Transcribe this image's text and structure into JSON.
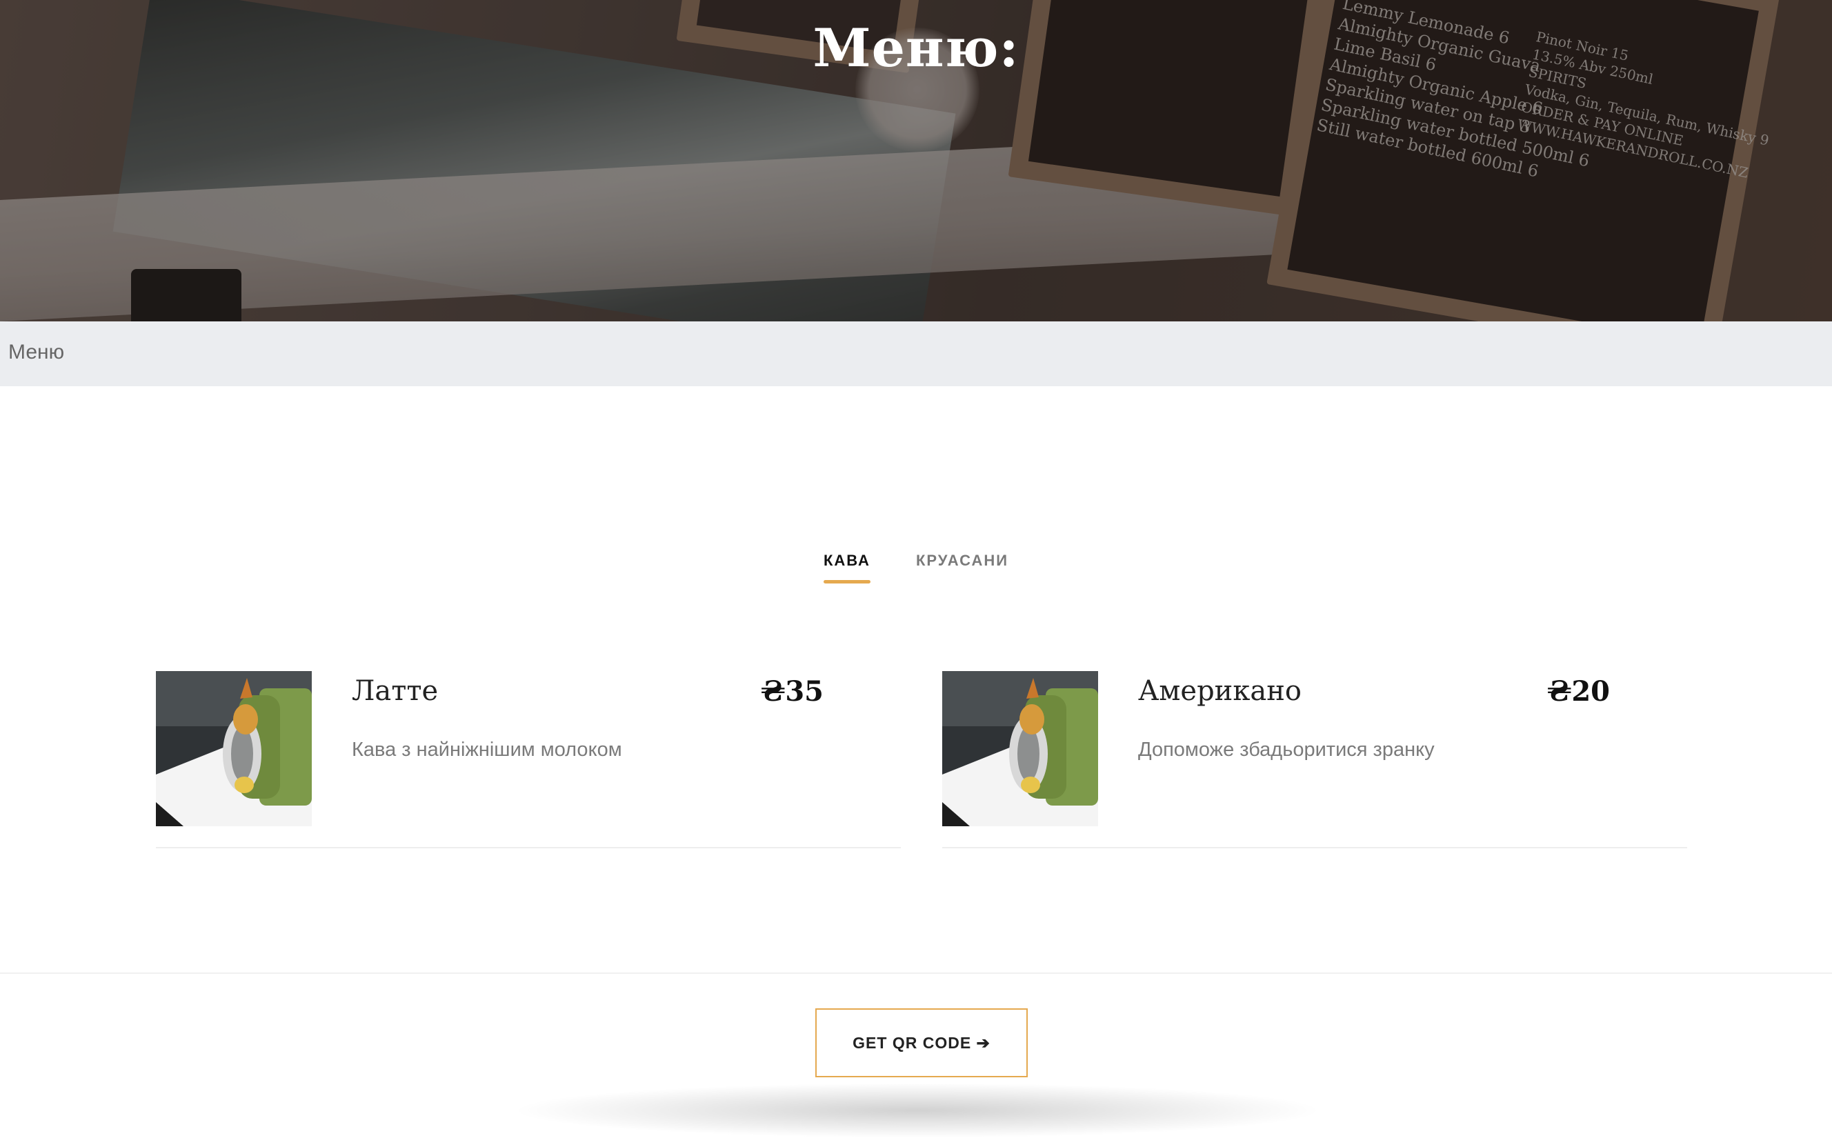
{
  "hero": {
    "title": "Меню:",
    "bg_chalk_lines_1": "Lemmy Lemonade 6\nAlmighty Organic Guava\nLime Basil 6\nAlmighty Organic Apple 6\nSparkling water on tap 3\nSparkling water bottled 500ml 6\nStill water bottled 600ml 6",
    "bg_chalk_lines_2": "Pinot Noir 15\n13.5% Abv 250ml\nSPIRITS\nVodka, Gin, Tequila, Rum, Whisky 9\nORDER & PAY ONLINE\nWWW.HAWKERANDROLL.CO.NZ"
  },
  "breadcrumb": {
    "current": "Меню"
  },
  "tabs": [
    {
      "label": "КАВА",
      "active": true
    },
    {
      "label": "КРУАСАНИ",
      "active": false
    }
  ],
  "menu_items": [
    {
      "name": "Латте",
      "price": "₴35",
      "description": "Кава з найніжнішим молоком",
      "image_icon": "sushi-roll-photo"
    },
    {
      "name": "Американо",
      "price": "₴20",
      "description": "Допоможе збадьоритися зранку",
      "image_icon": "sushi-roll-photo"
    }
  ],
  "footer": {
    "qr_button_label": "GET QR CODE ➔"
  },
  "colors": {
    "accent": "#e5a94f",
    "breadcrumb_bg": "#ebedf0",
    "text_muted": "#7a7a7a"
  }
}
